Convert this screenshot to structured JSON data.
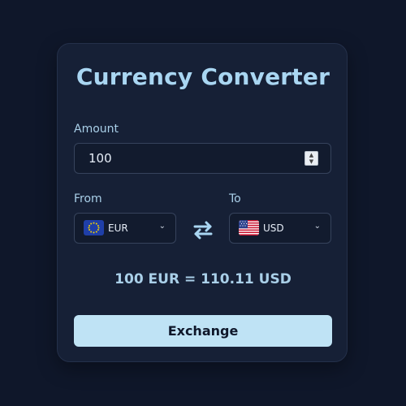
{
  "title": "Currency Converter",
  "amount": {
    "label": "Amount",
    "value": "100"
  },
  "from": {
    "label": "From",
    "currency": "EUR",
    "flag": "eu-flag-icon"
  },
  "to": {
    "label": "To",
    "currency": "USD",
    "flag": "us-flag-icon"
  },
  "swap_icon": "swap-arrows-icon",
  "result": "100 EUR = 110.11 USD",
  "exchange_button": "Exchange",
  "colors": {
    "background": "#0f172a",
    "card": "#162036",
    "accent": "#a9d6f2",
    "button": "#bfe3f5"
  }
}
